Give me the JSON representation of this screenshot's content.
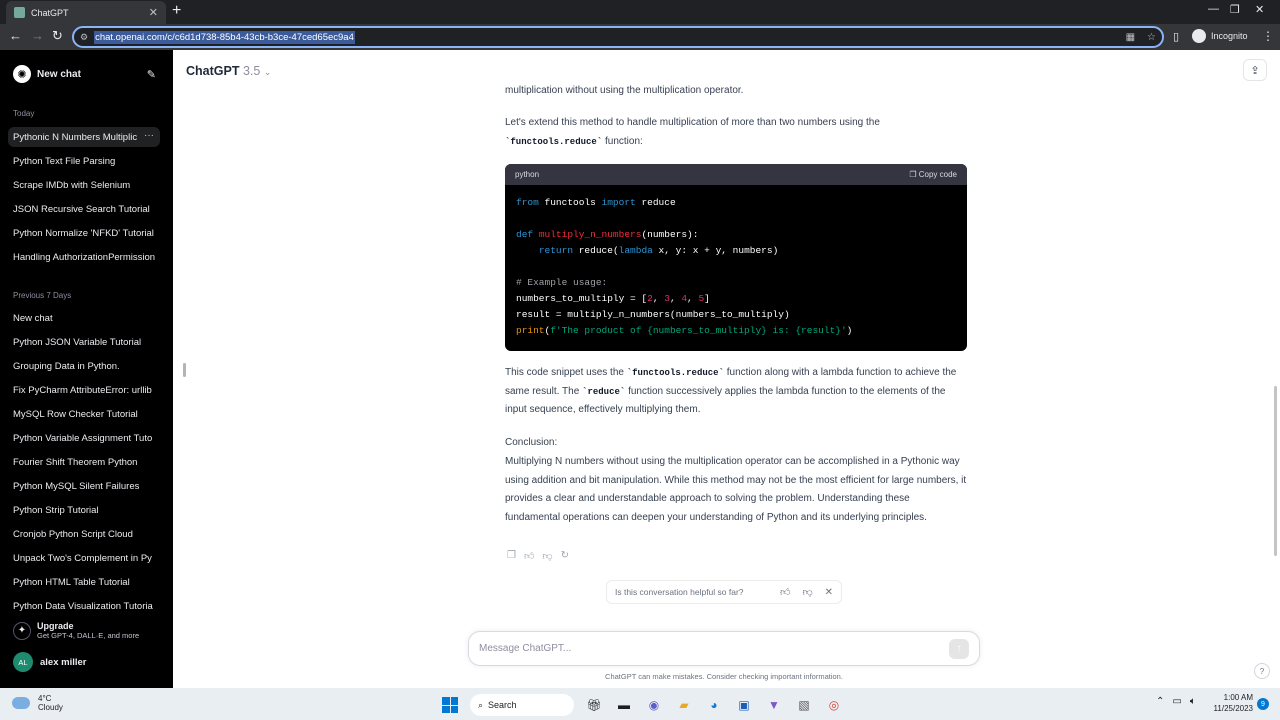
{
  "browser": {
    "tab_title": "ChatGPT",
    "url": "chat.openai.com/c/c6d1d738-85b4-43cb-b3ce-47ced65ec9a4",
    "incognito_label": "Incognito"
  },
  "sidebar": {
    "new_chat": "New chat",
    "today_label": "Today",
    "today_items": [
      "Pythonic N Numbers Multiplic",
      "Python Text File Parsing",
      "Scrape IMDb with Selenium",
      "JSON Recursive Search Tutorial",
      "Python Normalize 'NFKD' Tutorial",
      "Handling AuthorizationPermission"
    ],
    "prev_label": "Previous 7 Days",
    "prev_items": [
      "New chat",
      "Python JSON Variable Tutorial",
      "Grouping Data in Python.",
      "Fix PyCharm AttributeError: urllib",
      "MySQL Row Checker Tutorial",
      "Python Variable Assignment Tuto",
      "Fourier Shift Theorem Python",
      "Python MySQL Silent Failures",
      "Python Strip Tutorial",
      "Cronjob Python Script Cloud",
      "Unpack Two's Complement in Py",
      "Python HTML Table Tutorial",
      "Python Data Visualization Tutoria"
    ],
    "upgrade_title": "Upgrade",
    "upgrade_sub": "Get GPT-4, DALL·E, and more",
    "user_initials": "AL",
    "user_name": "alex miller"
  },
  "main": {
    "model_name": "ChatGPT",
    "model_version": "3.5",
    "faded_line": "multiplication without using the multiplication operator.",
    "para1_a": "Let's extend this method to handle multiplication of more than two numbers using the",
    "para1_code": "`functools.reduce`",
    "para1_b": " function:",
    "code_lang": "python",
    "copy_label": "Copy code",
    "para2_a": "This code snippet uses the ",
    "para2_code1": "`functools.reduce`",
    "para2_b": " function along with a lambda function to achieve the same result. The ",
    "para2_code2": "`reduce`",
    "para2_c": " function successively applies the lambda function to the elements of the input sequence, effectively multiplying them.",
    "conclusion_label": "Conclusion:",
    "conclusion_text": "Multiplying N numbers without using the multiplication operator can be accomplished in a Pythonic way using addition and bit manipulation. While this method may not be the most efficient for large numbers, it provides a clear and understandable approach to solving the problem. Understanding these fundamental operations can deepen your understanding of Python and its underlying principles.",
    "feedback_question": "Is this conversation helpful so far?",
    "composer_placeholder": "Message ChatGPT...",
    "disclaimer": "ChatGPT can make mistakes. Consider checking important information.",
    "help": "?"
  },
  "taskbar": {
    "temp": "4°C",
    "weather": "Cloudy",
    "search_label": "Search",
    "time": "1:00 AM",
    "date": "11/25/2023",
    "notif_count": "9"
  }
}
